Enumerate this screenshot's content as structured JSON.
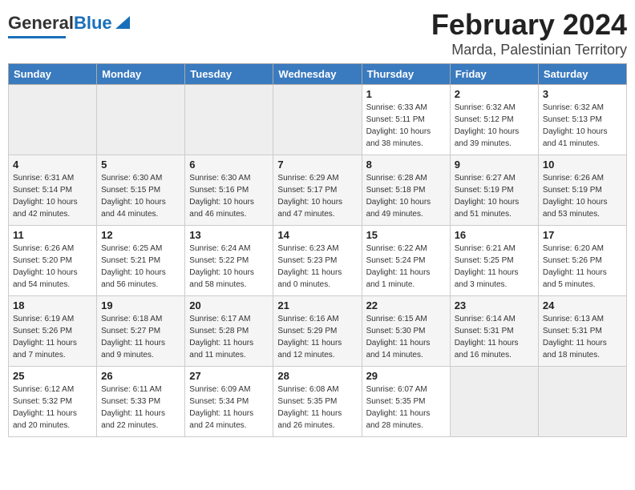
{
  "header": {
    "logo_general": "General",
    "logo_blue": "Blue",
    "month_year": "February 2024",
    "location": "Marda, Palestinian Territory"
  },
  "weekdays": [
    "Sunday",
    "Monday",
    "Tuesday",
    "Wednesday",
    "Thursday",
    "Friday",
    "Saturday"
  ],
  "weeks": [
    [
      {
        "day": "",
        "info": ""
      },
      {
        "day": "",
        "info": ""
      },
      {
        "day": "",
        "info": ""
      },
      {
        "day": "",
        "info": ""
      },
      {
        "day": "1",
        "info": "Sunrise: 6:33 AM\nSunset: 5:11 PM\nDaylight: 10 hours\nand 38 minutes."
      },
      {
        "day": "2",
        "info": "Sunrise: 6:32 AM\nSunset: 5:12 PM\nDaylight: 10 hours\nand 39 minutes."
      },
      {
        "day": "3",
        "info": "Sunrise: 6:32 AM\nSunset: 5:13 PM\nDaylight: 10 hours\nand 41 minutes."
      }
    ],
    [
      {
        "day": "4",
        "info": "Sunrise: 6:31 AM\nSunset: 5:14 PM\nDaylight: 10 hours\nand 42 minutes."
      },
      {
        "day": "5",
        "info": "Sunrise: 6:30 AM\nSunset: 5:15 PM\nDaylight: 10 hours\nand 44 minutes."
      },
      {
        "day": "6",
        "info": "Sunrise: 6:30 AM\nSunset: 5:16 PM\nDaylight: 10 hours\nand 46 minutes."
      },
      {
        "day": "7",
        "info": "Sunrise: 6:29 AM\nSunset: 5:17 PM\nDaylight: 10 hours\nand 47 minutes."
      },
      {
        "day": "8",
        "info": "Sunrise: 6:28 AM\nSunset: 5:18 PM\nDaylight: 10 hours\nand 49 minutes."
      },
      {
        "day": "9",
        "info": "Sunrise: 6:27 AM\nSunset: 5:19 PM\nDaylight: 10 hours\nand 51 minutes."
      },
      {
        "day": "10",
        "info": "Sunrise: 6:26 AM\nSunset: 5:19 PM\nDaylight: 10 hours\nand 53 minutes."
      }
    ],
    [
      {
        "day": "11",
        "info": "Sunrise: 6:26 AM\nSunset: 5:20 PM\nDaylight: 10 hours\nand 54 minutes."
      },
      {
        "day": "12",
        "info": "Sunrise: 6:25 AM\nSunset: 5:21 PM\nDaylight: 10 hours\nand 56 minutes."
      },
      {
        "day": "13",
        "info": "Sunrise: 6:24 AM\nSunset: 5:22 PM\nDaylight: 10 hours\nand 58 minutes."
      },
      {
        "day": "14",
        "info": "Sunrise: 6:23 AM\nSunset: 5:23 PM\nDaylight: 11 hours\nand 0 minutes."
      },
      {
        "day": "15",
        "info": "Sunrise: 6:22 AM\nSunset: 5:24 PM\nDaylight: 11 hours\nand 1 minute."
      },
      {
        "day": "16",
        "info": "Sunrise: 6:21 AM\nSunset: 5:25 PM\nDaylight: 11 hours\nand 3 minutes."
      },
      {
        "day": "17",
        "info": "Sunrise: 6:20 AM\nSunset: 5:26 PM\nDaylight: 11 hours\nand 5 minutes."
      }
    ],
    [
      {
        "day": "18",
        "info": "Sunrise: 6:19 AM\nSunset: 5:26 PM\nDaylight: 11 hours\nand 7 minutes."
      },
      {
        "day": "19",
        "info": "Sunrise: 6:18 AM\nSunset: 5:27 PM\nDaylight: 11 hours\nand 9 minutes."
      },
      {
        "day": "20",
        "info": "Sunrise: 6:17 AM\nSunset: 5:28 PM\nDaylight: 11 hours\nand 11 minutes."
      },
      {
        "day": "21",
        "info": "Sunrise: 6:16 AM\nSunset: 5:29 PM\nDaylight: 11 hours\nand 12 minutes."
      },
      {
        "day": "22",
        "info": "Sunrise: 6:15 AM\nSunset: 5:30 PM\nDaylight: 11 hours\nand 14 minutes."
      },
      {
        "day": "23",
        "info": "Sunrise: 6:14 AM\nSunset: 5:31 PM\nDaylight: 11 hours\nand 16 minutes."
      },
      {
        "day": "24",
        "info": "Sunrise: 6:13 AM\nSunset: 5:31 PM\nDaylight: 11 hours\nand 18 minutes."
      }
    ],
    [
      {
        "day": "25",
        "info": "Sunrise: 6:12 AM\nSunset: 5:32 PM\nDaylight: 11 hours\nand 20 minutes."
      },
      {
        "day": "26",
        "info": "Sunrise: 6:11 AM\nSunset: 5:33 PM\nDaylight: 11 hours\nand 22 minutes."
      },
      {
        "day": "27",
        "info": "Sunrise: 6:09 AM\nSunset: 5:34 PM\nDaylight: 11 hours\nand 24 minutes."
      },
      {
        "day": "28",
        "info": "Sunrise: 6:08 AM\nSunset: 5:35 PM\nDaylight: 11 hours\nand 26 minutes."
      },
      {
        "day": "29",
        "info": "Sunrise: 6:07 AM\nSunset: 5:35 PM\nDaylight: 11 hours\nand 28 minutes."
      },
      {
        "day": "",
        "info": ""
      },
      {
        "day": "",
        "info": ""
      }
    ]
  ]
}
